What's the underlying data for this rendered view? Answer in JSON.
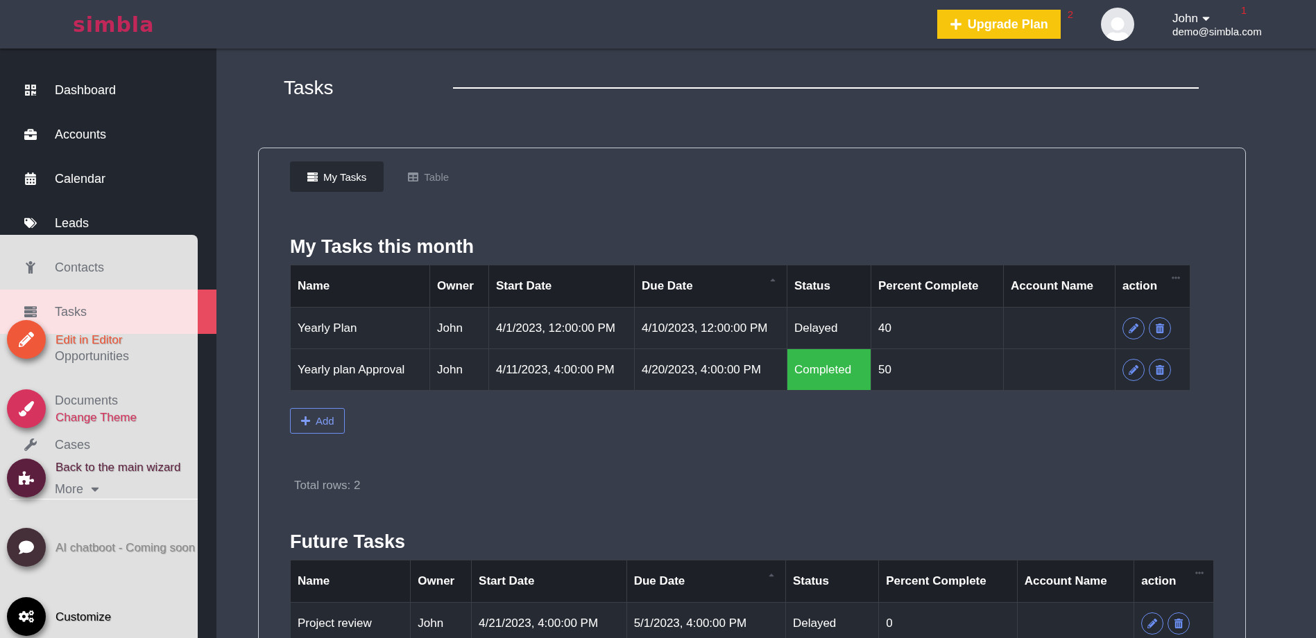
{
  "topbar": {
    "logo": "simbla",
    "upgrade_button": "Upgrade Plan",
    "upgrade_badge": "2",
    "user": {
      "name": "John",
      "email": "demo@simbla.com",
      "badge": "1"
    }
  },
  "sidebar": {
    "items": [
      {
        "label": "Dashboard",
        "selected": false
      },
      {
        "label": "Accounts",
        "selected": false
      },
      {
        "label": "Calendar",
        "selected": false
      },
      {
        "label": "Leads",
        "selected": false
      },
      {
        "label": "Contacts",
        "selected": false
      },
      {
        "label": "Tasks",
        "selected": true
      },
      {
        "label": "Opportunities",
        "selected": false
      },
      {
        "label": "Documents",
        "selected": false
      },
      {
        "label": "Cases",
        "selected": false
      },
      {
        "label": "More",
        "selected": false
      }
    ]
  },
  "overlay": {
    "actions": [
      {
        "label": "Edit in Editor",
        "color": "#f0583a",
        "disabled": false,
        "separated": false
      },
      {
        "label": "Change Theme",
        "color": "#d6335e",
        "disabled": false,
        "separated": false
      },
      {
        "label": "Back to the main wizard",
        "color": "#5c1f3d",
        "disabled": false,
        "separated": false
      },
      {
        "label": "AI chatboot - Coming soon",
        "color": "#45303a",
        "disabled": true,
        "separated": true
      },
      {
        "label": "Customize",
        "color": "#000000",
        "disabled": false,
        "separated": false
      }
    ]
  },
  "page": {
    "title": "Tasks"
  },
  "tabs": [
    {
      "label": "My Tasks",
      "selected": true
    },
    {
      "label": "Table",
      "selected": false
    }
  ],
  "sections": [
    {
      "title": "My Tasks this month",
      "columns": [
        "Name",
        "Owner",
        "Start Date",
        "Due Date",
        "Status",
        "Percent Complete",
        "Account Name",
        "action"
      ],
      "rows": [
        {
          "cells": [
            "Yearly Plan",
            "John",
            "4/1/2023, 12:00:00 PM",
            "4/10/2023, 12:00:00 PM",
            "Delayed",
            "40",
            ""
          ],
          "status_highlighted": false
        },
        {
          "cells": [
            "Yearly plan Approval",
            "John",
            "4/11/2023, 4:00:00 PM",
            "4/20/2023, 4:00:00 PM",
            "Completed",
            "50",
            ""
          ],
          "status_highlighted": true
        }
      ],
      "add_button": "Add",
      "total": "Total rows: 2"
    },
    {
      "title": "Future Tasks",
      "columns": [
        "Name",
        "Owner",
        "Start Date",
        "Due Date",
        "Status",
        "Percent Complete",
        "Account Name",
        "action"
      ],
      "rows": [
        {
          "cells": [
            "Project review",
            "John",
            "4/21/2023, 4:00:00 PM",
            "5/1/2023, 4:00:00 PM",
            "Delayed",
            "0",
            ""
          ],
          "status_highlighted": false
        }
      ]
    }
  ]
}
